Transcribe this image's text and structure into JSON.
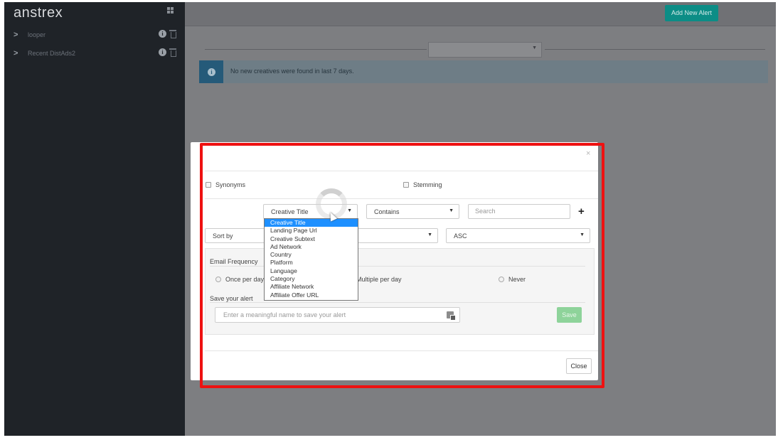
{
  "sidebar": {
    "brand": "anstrex",
    "items": [
      {
        "label": "looper"
      },
      {
        "label": "Recent DistAds2"
      }
    ]
  },
  "header": {
    "add_alert_label": "Add New Alert"
  },
  "main": {
    "filter_select_value": "",
    "notice_text": "No new creatives were found in last 7 days."
  },
  "modal": {
    "close_x": "×",
    "synonyms_label": "Synonyms",
    "stemming_label": "Stemming",
    "field_select": {
      "value": "Creative Title",
      "options": [
        "Creative Title",
        "Landing Page Url",
        "Creative Subtext",
        "Ad Network",
        "Country",
        "Platform",
        "Language",
        "Category",
        "Affiliate Network",
        "Affiliate Offer URL"
      ],
      "selected_index": 0
    },
    "operator_select_value": "Contains",
    "search_placeholder": "Search",
    "sort_by_value": "Sort by",
    "order_value": "ASC",
    "email_frequency": {
      "title": "Email Frequency",
      "options": [
        "Once per day",
        "Multiple per day",
        "Never"
      ]
    },
    "save_alert_label": "Save your alert",
    "alert_name_placeholder": "Enter a meaningful name to save your alert",
    "save_button": "Save",
    "close_button": "Close"
  },
  "colors": {
    "highlight": "#ee1111",
    "accent": "#0c8d86",
    "dropdown_selected": "#1e90ff",
    "save_button": "#8ed39a"
  }
}
